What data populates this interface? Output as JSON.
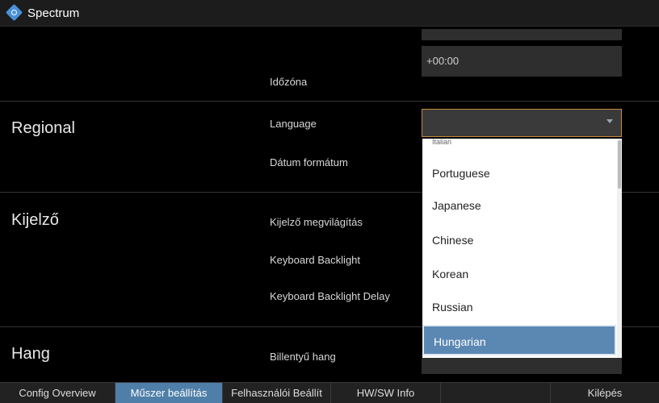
{
  "window": {
    "title": "Spectrum",
    "icon": "spectrum-logo-icon"
  },
  "sections": {
    "regional": "Regional",
    "display": "Kijelző",
    "sound": "Hang"
  },
  "labels": {
    "timezone": "Időzóna",
    "language": "Language",
    "date_format": "Dátum formátum",
    "display_backlight": "Kijelző megvilágítás",
    "keyboard_backlight": "Keyboard Backlight",
    "keyboard_backlight_delay": "Keyboard Backlight Delay",
    "key_sound": "Billentyű hang"
  },
  "fields": {
    "timezone_value": "+00:00",
    "language_value": ""
  },
  "language_dropdown": {
    "items": [
      "Italian",
      "Portuguese",
      "Japanese",
      "Chinese",
      "Korean",
      "Russian",
      "Hungarian"
    ],
    "selected": "Hungarian"
  },
  "bottom_tabs": {
    "config_overview": "Config Overview",
    "instrument_settings": "Műszer beállítás",
    "user_settings": "Felhasználói Beállít",
    "hwsw_info": "HW/SW Info",
    "exit": "Kilépés"
  },
  "colors": {
    "active_tab": "#4f7fa8",
    "selected_item": "#5b87b3",
    "focus_border": "#c98a3a"
  }
}
